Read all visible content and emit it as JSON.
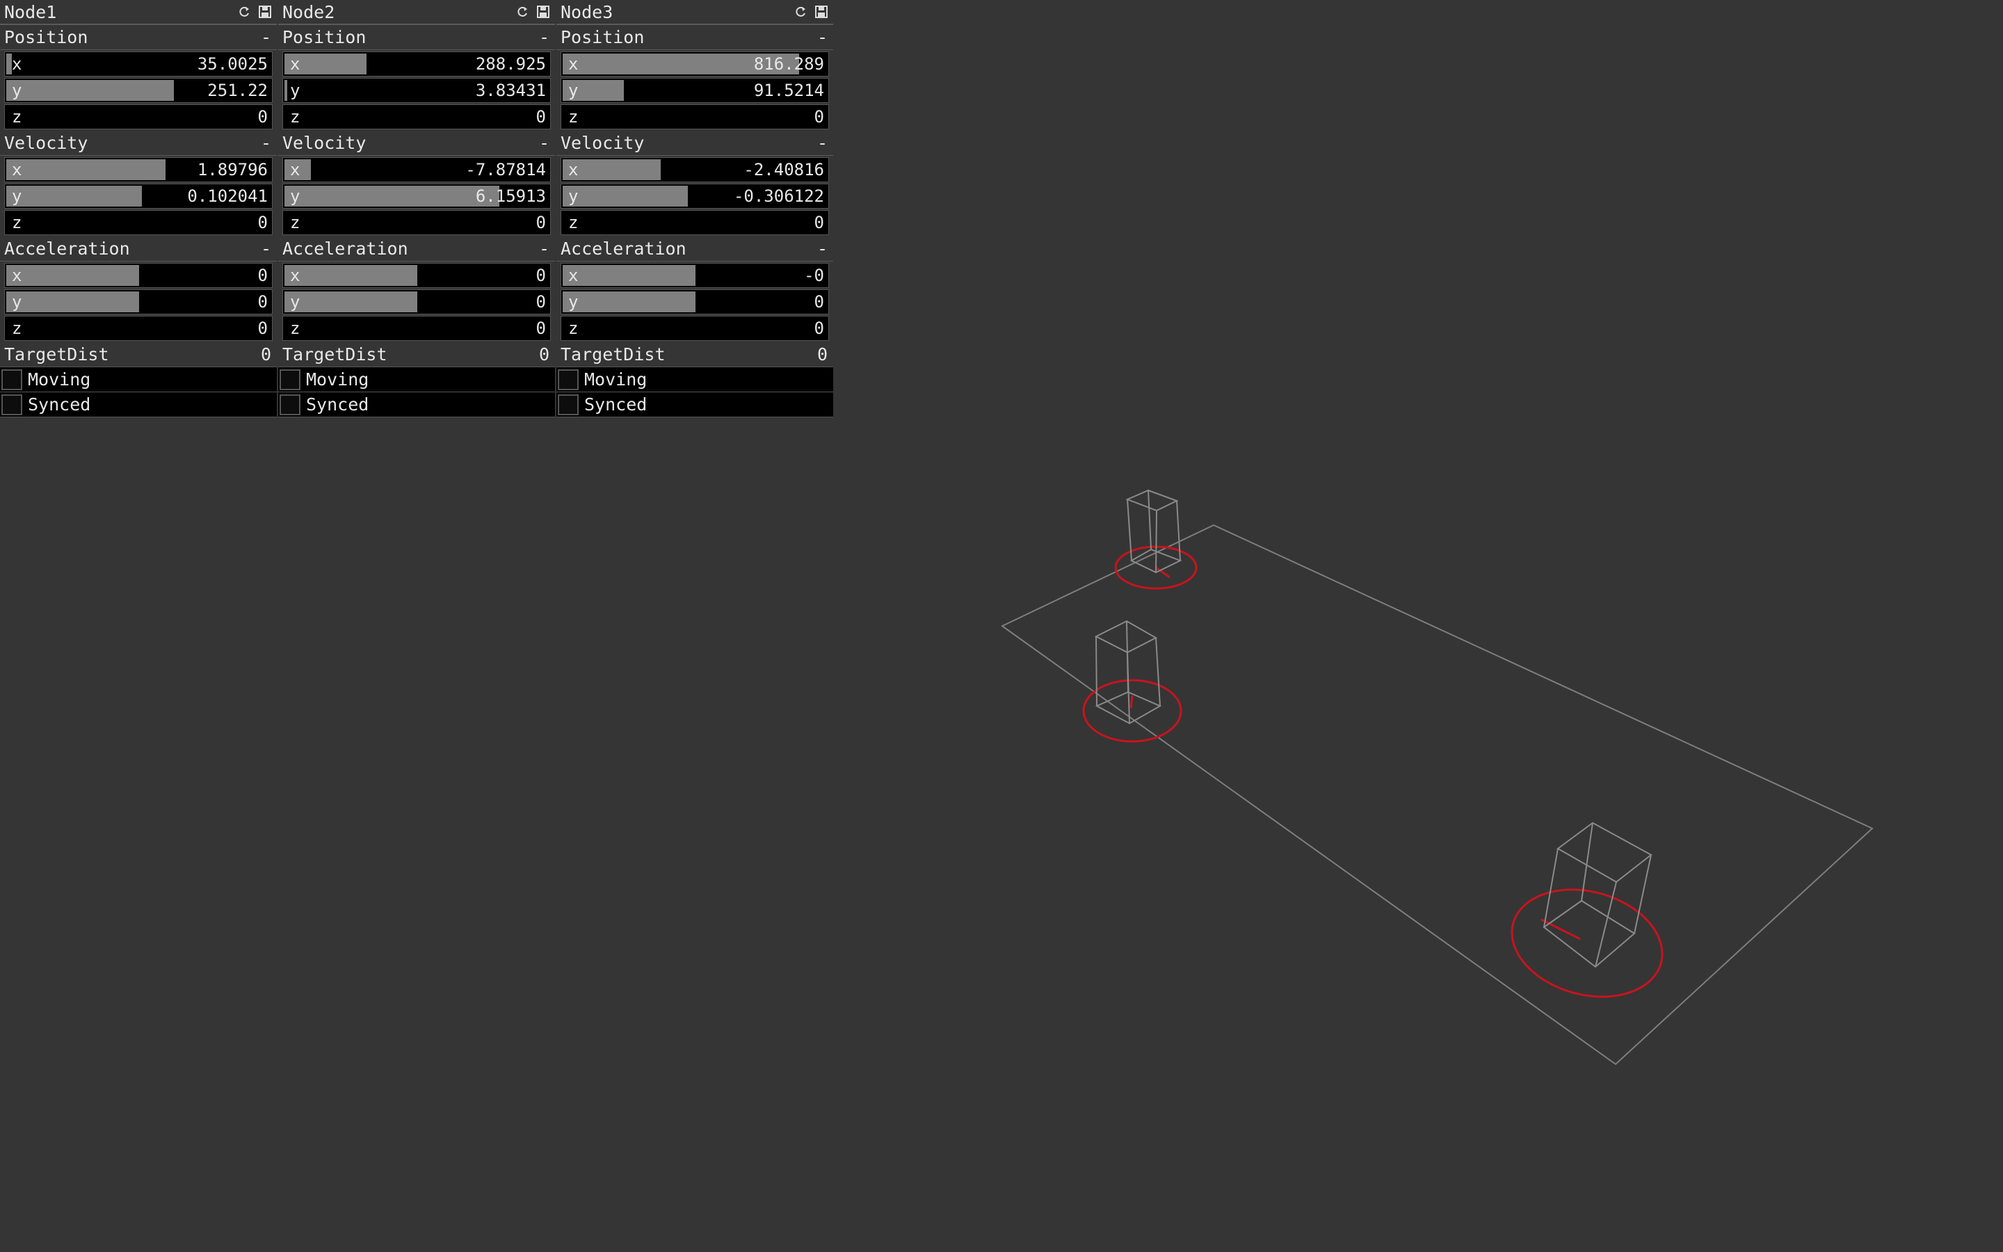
{
  "panels": [
    {
      "title": "Node1",
      "groups": [
        {
          "name": "Position",
          "collapse": "-",
          "rows": [
            {
              "axis": "x",
              "value": "35.0025",
              "fill": 0.02
            },
            {
              "axis": "y",
              "value": "251.22",
              "fill": 0.63
            },
            {
              "axis": "z",
              "value": "0",
              "fill": 0
            }
          ]
        },
        {
          "name": "Velocity",
          "collapse": "-",
          "rows": [
            {
              "axis": "x",
              "value": "1.89796",
              "fill": 0.6
            },
            {
              "axis": "y",
              "value": "0.102041",
              "fill": 0.51
            },
            {
              "axis": "z",
              "value": "0",
              "fill": 0
            }
          ]
        },
        {
          "name": "Acceleration",
          "collapse": "-",
          "rows": [
            {
              "axis": "x",
              "value": "0",
              "fill": 0.5
            },
            {
              "axis": "y",
              "value": "0",
              "fill": 0.5
            },
            {
              "axis": "z",
              "value": "0",
              "fill": 0
            }
          ]
        }
      ],
      "target_label": "TargetDist",
      "target_value": "0",
      "moving_label": "Moving",
      "synced_label": "Synced"
    },
    {
      "title": "Node2",
      "groups": [
        {
          "name": "Position",
          "collapse": "-",
          "rows": [
            {
              "axis": "x",
              "value": "288.925",
              "fill": 0.31
            },
            {
              "axis": "y",
              "value": "3.83431",
              "fill": 0.01
            },
            {
              "axis": "z",
              "value": "0",
              "fill": 0
            }
          ]
        },
        {
          "name": "Velocity",
          "collapse": "-",
          "rows": [
            {
              "axis": "x",
              "value": "-7.87814",
              "fill": 0.1
            },
            {
              "axis": "y",
              "value": "6.15913",
              "fill": 0.81
            },
            {
              "axis": "z",
              "value": "0",
              "fill": 0
            }
          ]
        },
        {
          "name": "Acceleration",
          "collapse": "-",
          "rows": [
            {
              "axis": "x",
              "value": "0",
              "fill": 0.5
            },
            {
              "axis": "y",
              "value": "0",
              "fill": 0.5
            },
            {
              "axis": "z",
              "value": "0",
              "fill": 0
            }
          ]
        }
      ],
      "target_label": "TargetDist",
      "target_value": "0",
      "moving_label": "Moving",
      "synced_label": "Synced"
    },
    {
      "title": "Node3",
      "groups": [
        {
          "name": "Position",
          "collapse": "-",
          "rows": [
            {
              "axis": "x",
              "value": "816.289",
              "fill": 0.89
            },
            {
              "axis": "y",
              "value": "91.5214",
              "fill": 0.23
            },
            {
              "axis": "z",
              "value": "0",
              "fill": 0
            }
          ]
        },
        {
          "name": "Velocity",
          "collapse": "-",
          "rows": [
            {
              "axis": "x",
              "value": "-2.40816",
              "fill": 0.37
            },
            {
              "axis": "y",
              "value": "-0.306122",
              "fill": 0.47
            },
            {
              "axis": "z",
              "value": "0",
              "fill": 0
            }
          ]
        },
        {
          "name": "Acceleration",
          "collapse": "-",
          "rows": [
            {
              "axis": "x",
              "value": "-0",
              "fill": 0.5
            },
            {
              "axis": "y",
              "value": "0",
              "fill": 0.5
            },
            {
              "axis": "z",
              "value": "0",
              "fill": 0
            }
          ]
        }
      ],
      "target_label": "TargetDist",
      "target_value": "0",
      "moving_label": "Moving",
      "synced_label": "Synced"
    }
  ],
  "header_icons": [
    "refresh-icon",
    "save-icon"
  ],
  "colors": {
    "background": "#353535",
    "slider_fill": "#808080",
    "wireframe": "#8a8a8a",
    "marker": "#c8141e"
  }
}
